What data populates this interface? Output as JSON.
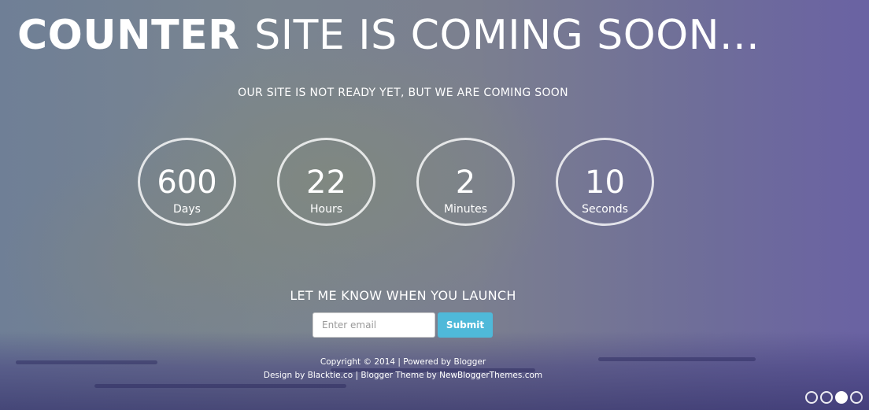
{
  "colors": {
    "submit_bg": "#4fb9d9",
    "text": "#ffffff"
  },
  "header": {
    "title_bold": "COUNTER",
    "title_rest": "SITE IS COMING SOON..."
  },
  "subtitle": "OUR SITE IS NOT READY YET, BUT WE ARE COMING SOON",
  "countdown": [
    {
      "value": "600",
      "label": "Days"
    },
    {
      "value": "22",
      "label": "Hours"
    },
    {
      "value": "2",
      "label": "Minutes"
    },
    {
      "value": "10",
      "label": "Seconds"
    }
  ],
  "signup": {
    "title": "LET ME KNOW WHEN YOU LAUNCH",
    "placeholder": "Enter email",
    "submit_label": "Submit"
  },
  "footer": {
    "copyright_prefix": "Copyright © 2014 | Powered by",
    "blogger_link": "Blogger",
    "design_prefix": "Design by",
    "blacktie_link": "Blacktie.co",
    "theme_prefix": "| Blogger Theme by",
    "theme_link": "NewBloggerThemes.com"
  },
  "slider": {
    "total": 4,
    "active_index": 2,
    "icons": [
      "dot-icon",
      "dot-icon",
      "dot-icon-active",
      "dot-icon"
    ]
  }
}
